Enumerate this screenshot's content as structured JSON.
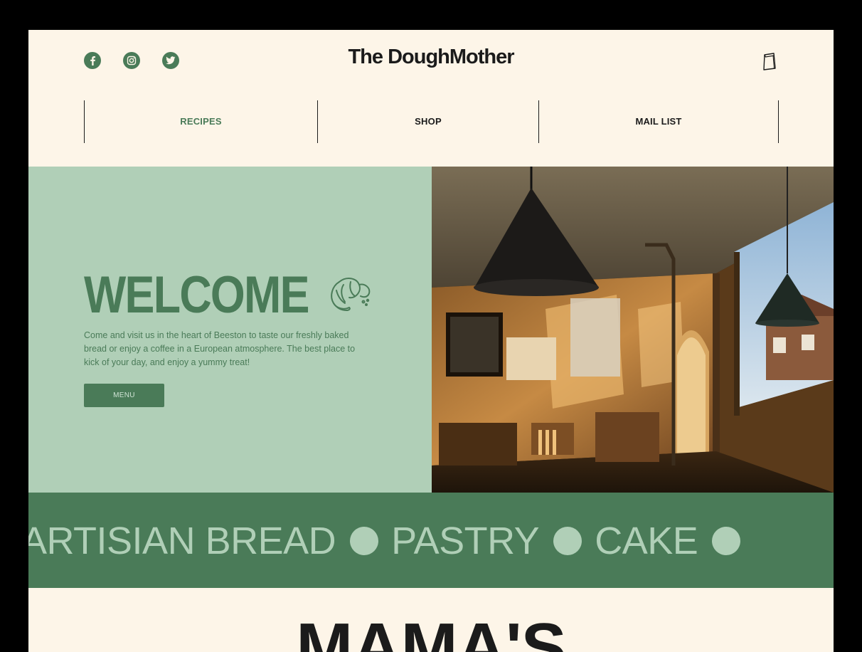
{
  "header": {
    "brand": "The DoughMother",
    "social": [
      {
        "icon": "facebook-icon"
      },
      {
        "icon": "instagram-icon"
      },
      {
        "icon": "twitter-icon"
      }
    ],
    "cart_icon": "shopping-bag-icon"
  },
  "nav": {
    "items": [
      {
        "label": "RECIPES",
        "active": true
      },
      {
        "label": "SHOP",
        "active": false
      },
      {
        "label": "MAIL LIST",
        "active": false
      }
    ]
  },
  "hero": {
    "title": "WELCOME",
    "icon": "croissant-icon",
    "text": "Come and visit us in the heart of Beeston to taste our freshly baked bread or enjoy a coffee in a European atmosphere. The best place to kick of your day, and enjoy a yummy treat!",
    "button_label": "MENU"
  },
  "ticker": {
    "items": [
      "ARTISIAN BREAD",
      "PASTRY",
      "CAKE"
    ]
  },
  "section": {
    "heading": "MAMA'S"
  },
  "colors": {
    "page_bg": "#fdf5e8",
    "brand_green": "#4a7b58",
    "light_green": "#b0cfb7",
    "text_dark": "#1b1b1b"
  }
}
